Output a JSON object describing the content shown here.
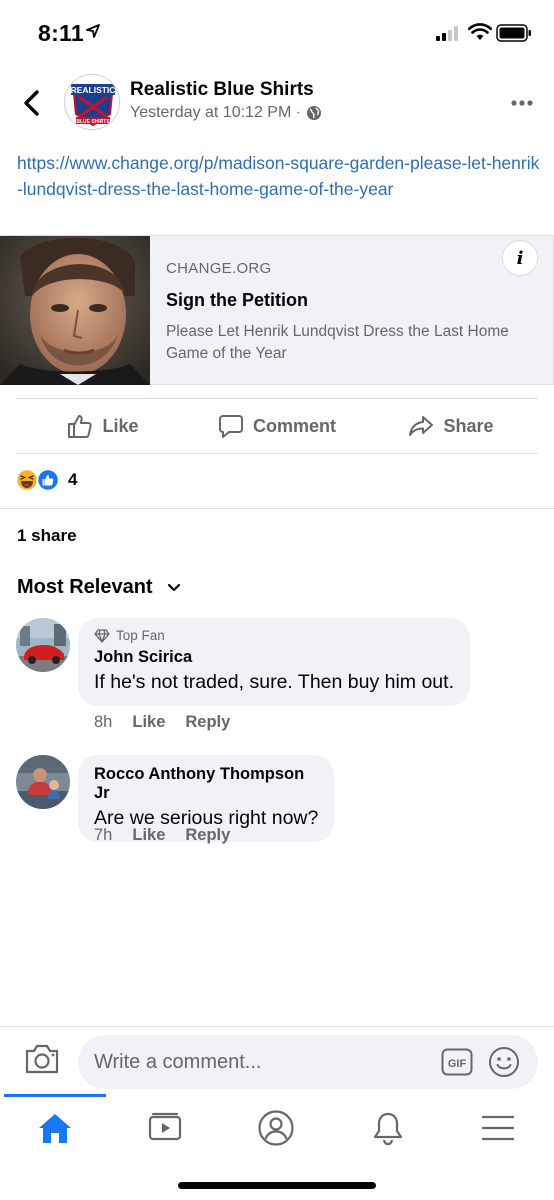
{
  "status_bar": {
    "time": "8:11"
  },
  "header": {
    "page_name": "Realistic Blue Shirts",
    "post_time": "Yesterday at 10:12 PM ·",
    "avatar_text_top": "REALISTIC",
    "avatar_text_bottom": "BLUE SHIRTS"
  },
  "post": {
    "link_text": "https://www.change.org/p/madison-square-garden-please-let-henrik-lundqvist-dress-the-last-home-game-of-the-year"
  },
  "link_card": {
    "domain": "CHANGE.ORG",
    "title": "Sign the Petition",
    "description": "Please Let Henrik Lundqvist Dress the Last Home Game of the Year",
    "info_label": "i"
  },
  "actions": {
    "like": "Like",
    "comment": "Comment",
    "share": "Share"
  },
  "reactions": {
    "count": "4"
  },
  "shares": "1 share",
  "comments_filter": "Most Relevant",
  "comments": [
    {
      "badge": "Top Fan",
      "author": "John Scirica",
      "text": "If he's not traded, sure. Then buy him out.",
      "time": "8h",
      "like": "Like",
      "reply": "Reply"
    },
    {
      "author": "Rocco Anthony Thompson Jr",
      "text": "Are we serious right now?",
      "time": "7h",
      "like": "Like",
      "reply": "Reply"
    }
  ],
  "composer": {
    "placeholder": "Write a comment...",
    "gif_label": "GIF"
  },
  "colors": {
    "accent": "#1877f2",
    "link": "#2f6fb0",
    "secondary_text": "#65676b",
    "bubble": "#f0f2f5"
  }
}
